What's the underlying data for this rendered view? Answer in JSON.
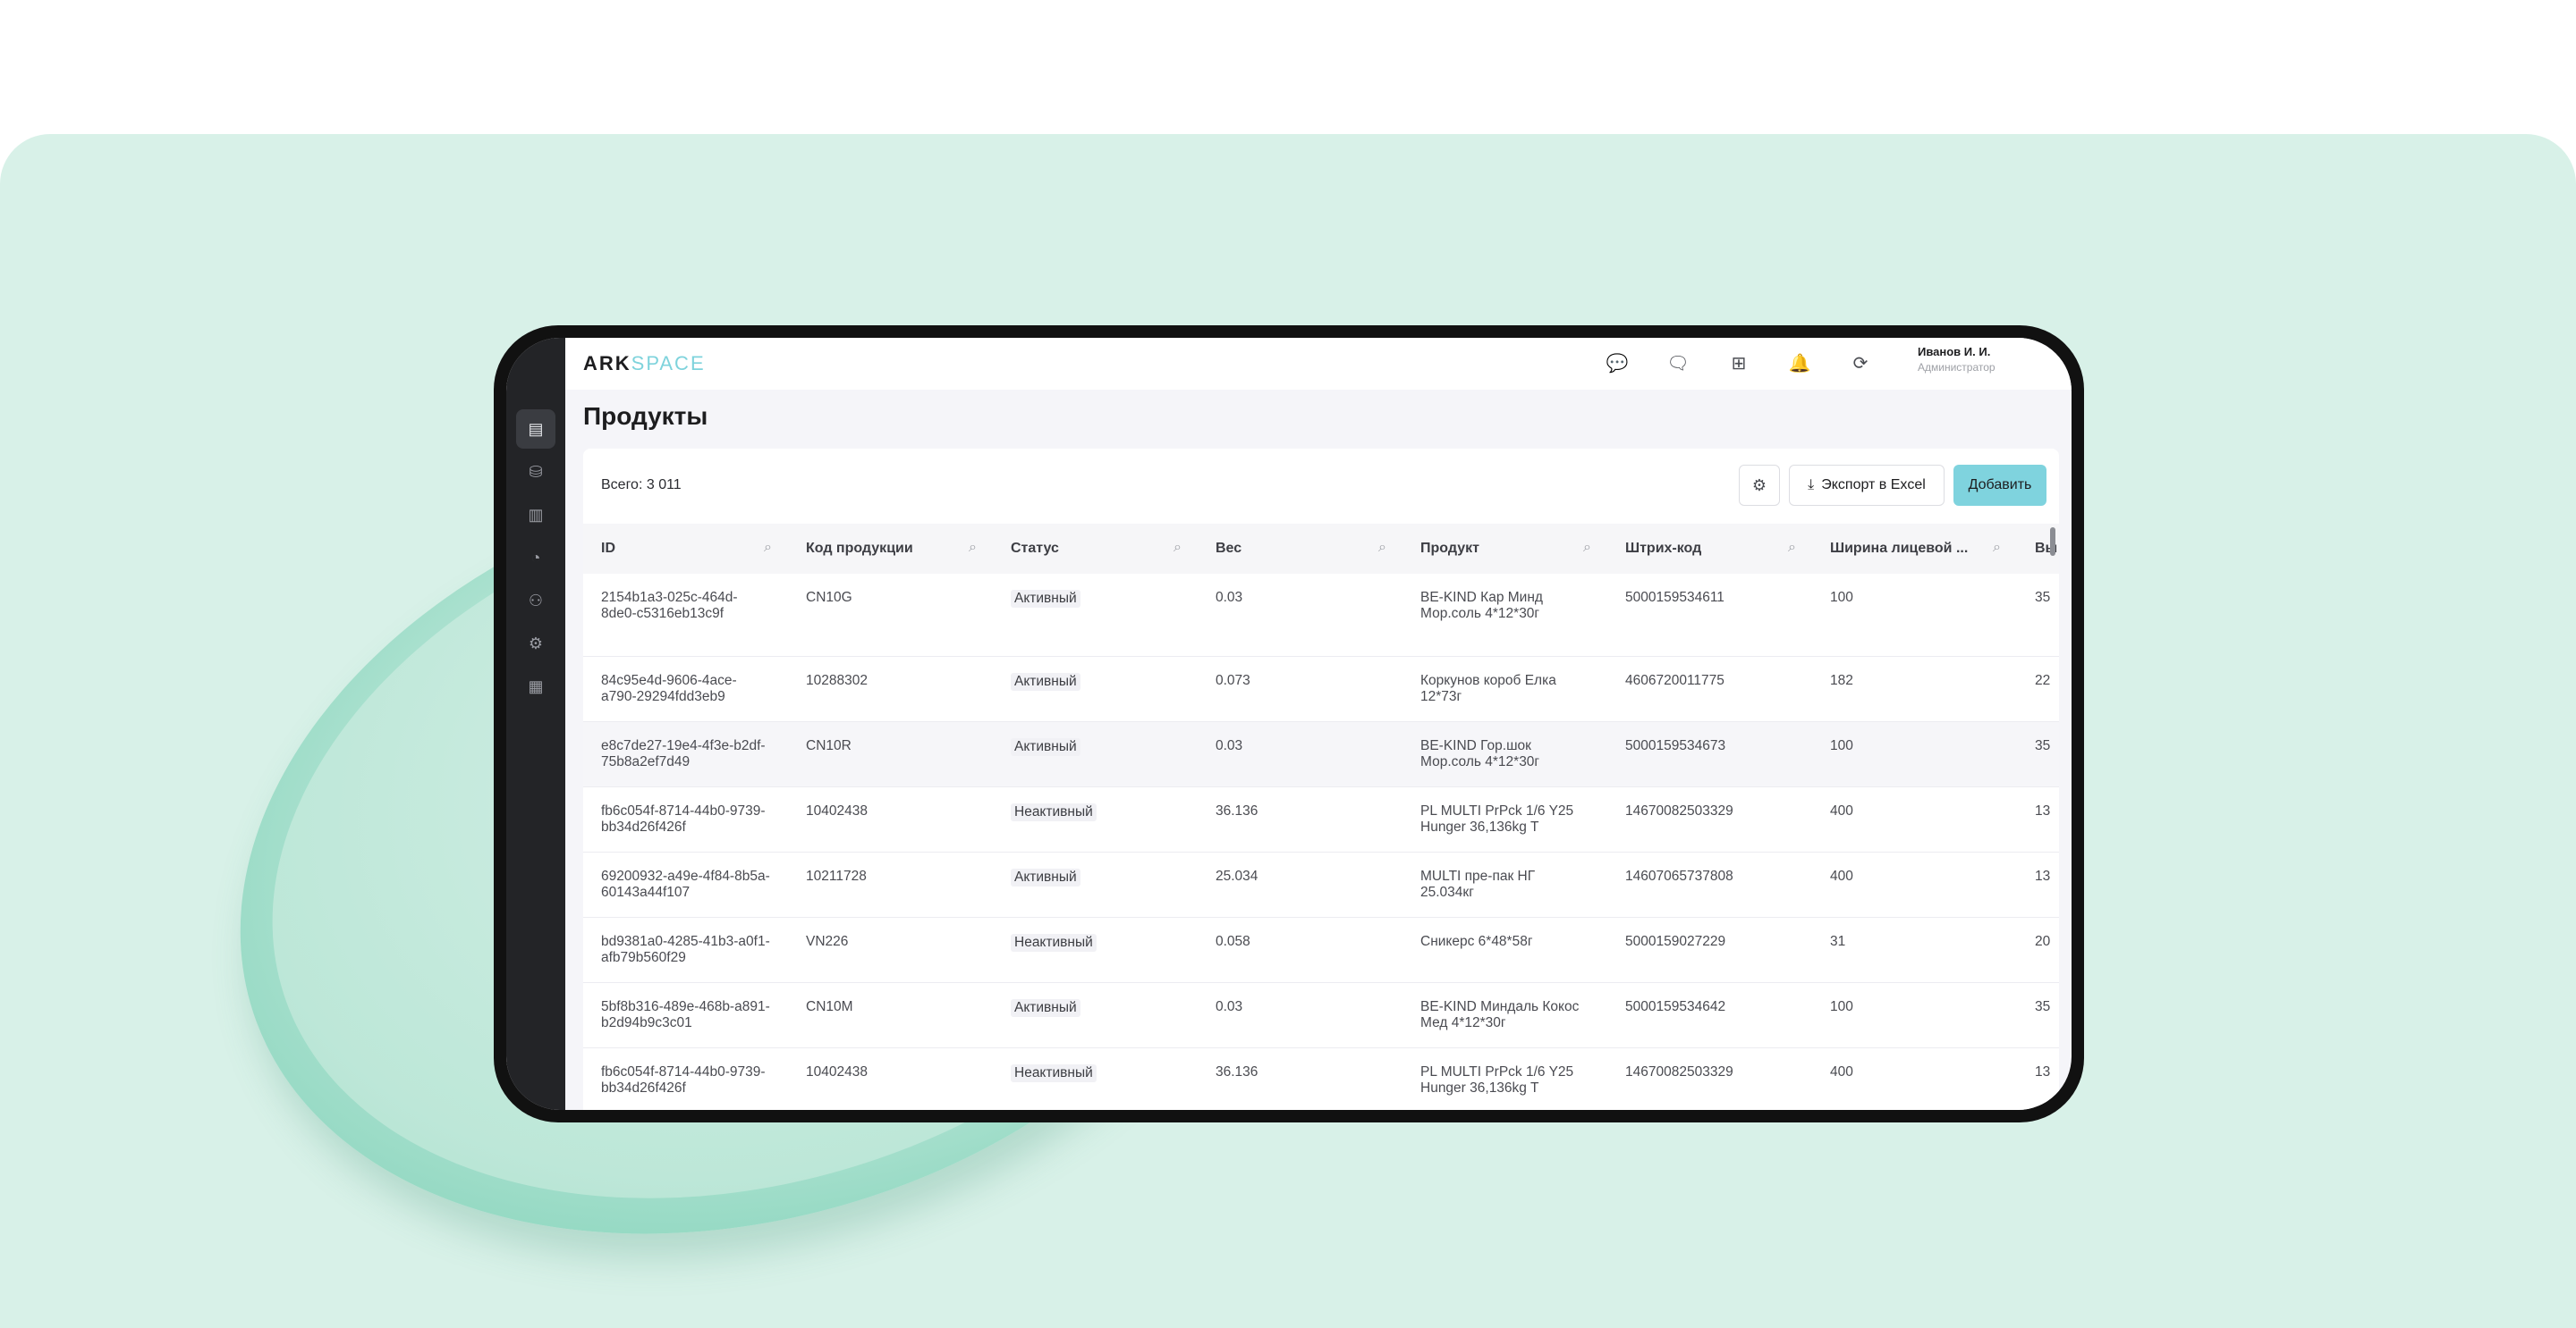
{
  "logo": {
    "main": "ARK",
    "accent": "SPACE"
  },
  "header": {
    "user_name": "Иванов И. И.",
    "user_role": "Администратор",
    "icons": [
      "support-chat-icon",
      "chat-icon",
      "apps-grid-icon",
      "bell-icon",
      "sync-icon"
    ]
  },
  "sidebar": {
    "items": [
      "products-icon",
      "database-icon",
      "layout-icon",
      "chart-icon",
      "users-icon",
      "settings-icon",
      "calendar-icon"
    ]
  },
  "page": {
    "title": "Продукты"
  },
  "toolbar": {
    "total": "Всего: 3 011",
    "export_label": "Экспорт в Excel",
    "add_label": "Добавить"
  },
  "table": {
    "columns": [
      "ID",
      "Код продукции",
      "Статус",
      "Вес",
      "Продукт",
      "Штрих-код",
      "Ширина лицевой ...",
      "Вы"
    ],
    "rows": [
      {
        "id": "2154b1a3-025c-464d-8de0-c5316eb13c9f",
        "code": "CN10G",
        "status": "Активный",
        "weight": "0.03",
        "product": "BE-KIND Кар Минд Мор.соль 4*12*30г",
        "barcode": "5000159534611",
        "width": "100",
        "extra": "35"
      },
      {
        "id": "84c95e4d-9606-4ace-a790-29294fdd3eb9",
        "code": "10288302",
        "status": "Активный",
        "weight": "0.073",
        "product": "Коркунов короб Елка 12*73г",
        "barcode": "4606720011775",
        "width": "182",
        "extra": "22"
      },
      {
        "id": "e8c7de27-19e4-4f3e-b2df-75b8a2ef7d49",
        "code": "CN10R",
        "status": "Активный",
        "weight": "0.03",
        "product": "BE-KIND Гор.шок Мор.соль 4*12*30г",
        "barcode": "5000159534673",
        "width": "100",
        "extra": "35"
      },
      {
        "id": "fb6c054f-8714-44b0-9739-bb34d26f426f",
        "code": "10402438",
        "status": "Неактивный",
        "weight": "36.136",
        "product": "PL MULTI PrPck 1/6 Y25 Hunger 36,136kg T",
        "barcode": "14670082503329",
        "width": "400",
        "extra": "13"
      },
      {
        "id": "69200932-a49e-4f84-8b5a-60143a44f107",
        "code": "10211728",
        "status": "Активный",
        "weight": "25.034",
        "product": "MULTI пре-пак НГ 25.034кг",
        "barcode": "14607065737808",
        "width": "400",
        "extra": "13"
      },
      {
        "id": "bd9381a0-4285-41b3-a0f1-afb79b560f29",
        "code": "VN226",
        "status": "Неактивный",
        "weight": "0.058",
        "product": "Сникерс 6*48*58г",
        "barcode": "5000159027229",
        "width": "31",
        "extra": "20"
      },
      {
        "id": "5bf8b316-489e-468b-a891-b2d94b9c3c01",
        "code": "CN10M",
        "status": "Активный",
        "weight": "0.03",
        "product": "BE-KIND Миндаль Кокос Мед 4*12*30г",
        "barcode": "5000159534642",
        "width": "100",
        "extra": "35"
      },
      {
        "id": "fb6c054f-8714-44b0-9739-bb34d26f426f",
        "code": "10402438",
        "status": "Неактивный",
        "weight": "36.136",
        "product": "PL MULTI PrPck 1/6 Y25 Hunger 36,136kg T",
        "barcode": "14670082503329",
        "width": "400",
        "extra": "13"
      }
    ]
  },
  "colors": {
    "accent": "#7fd3de",
    "sidebar": "#232427",
    "background": "#d8f1e8"
  }
}
